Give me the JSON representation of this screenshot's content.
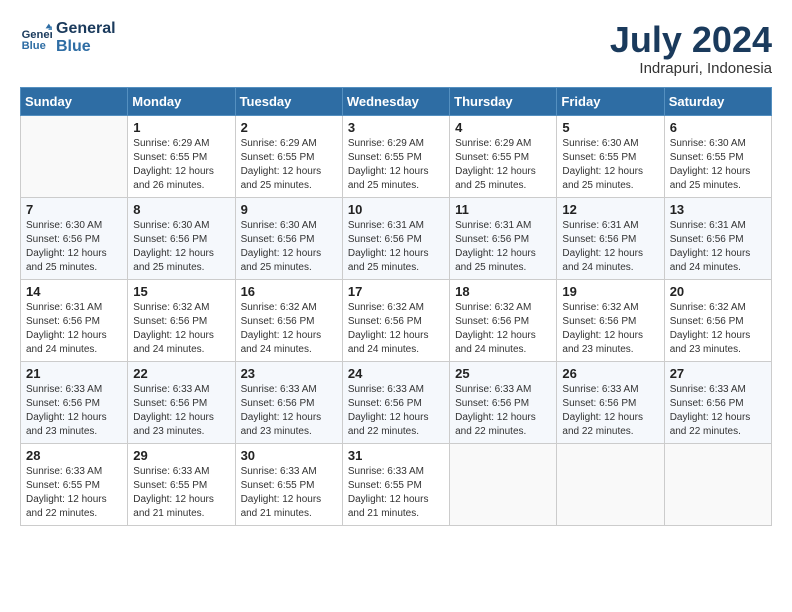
{
  "header": {
    "logo_line1": "General",
    "logo_line2": "Blue",
    "month": "July 2024",
    "location": "Indrapuri, Indonesia"
  },
  "weekdays": [
    "Sunday",
    "Monday",
    "Tuesday",
    "Wednesday",
    "Thursday",
    "Friday",
    "Saturday"
  ],
  "weeks": [
    [
      {
        "day": "",
        "info": ""
      },
      {
        "day": "1",
        "info": "Sunrise: 6:29 AM\nSunset: 6:55 PM\nDaylight: 12 hours\nand 26 minutes."
      },
      {
        "day": "2",
        "info": "Sunrise: 6:29 AM\nSunset: 6:55 PM\nDaylight: 12 hours\nand 25 minutes."
      },
      {
        "day": "3",
        "info": "Sunrise: 6:29 AM\nSunset: 6:55 PM\nDaylight: 12 hours\nand 25 minutes."
      },
      {
        "day": "4",
        "info": "Sunrise: 6:29 AM\nSunset: 6:55 PM\nDaylight: 12 hours\nand 25 minutes."
      },
      {
        "day": "5",
        "info": "Sunrise: 6:30 AM\nSunset: 6:55 PM\nDaylight: 12 hours\nand 25 minutes."
      },
      {
        "day": "6",
        "info": "Sunrise: 6:30 AM\nSunset: 6:55 PM\nDaylight: 12 hours\nand 25 minutes."
      }
    ],
    [
      {
        "day": "7",
        "info": "Sunrise: 6:30 AM\nSunset: 6:56 PM\nDaylight: 12 hours\nand 25 minutes."
      },
      {
        "day": "8",
        "info": "Sunrise: 6:30 AM\nSunset: 6:56 PM\nDaylight: 12 hours\nand 25 minutes."
      },
      {
        "day": "9",
        "info": "Sunrise: 6:30 AM\nSunset: 6:56 PM\nDaylight: 12 hours\nand 25 minutes."
      },
      {
        "day": "10",
        "info": "Sunrise: 6:31 AM\nSunset: 6:56 PM\nDaylight: 12 hours\nand 25 minutes."
      },
      {
        "day": "11",
        "info": "Sunrise: 6:31 AM\nSunset: 6:56 PM\nDaylight: 12 hours\nand 25 minutes."
      },
      {
        "day": "12",
        "info": "Sunrise: 6:31 AM\nSunset: 6:56 PM\nDaylight: 12 hours\nand 24 minutes."
      },
      {
        "day": "13",
        "info": "Sunrise: 6:31 AM\nSunset: 6:56 PM\nDaylight: 12 hours\nand 24 minutes."
      }
    ],
    [
      {
        "day": "14",
        "info": "Sunrise: 6:31 AM\nSunset: 6:56 PM\nDaylight: 12 hours\nand 24 minutes."
      },
      {
        "day": "15",
        "info": "Sunrise: 6:32 AM\nSunset: 6:56 PM\nDaylight: 12 hours\nand 24 minutes."
      },
      {
        "day": "16",
        "info": "Sunrise: 6:32 AM\nSunset: 6:56 PM\nDaylight: 12 hours\nand 24 minutes."
      },
      {
        "day": "17",
        "info": "Sunrise: 6:32 AM\nSunset: 6:56 PM\nDaylight: 12 hours\nand 24 minutes."
      },
      {
        "day": "18",
        "info": "Sunrise: 6:32 AM\nSunset: 6:56 PM\nDaylight: 12 hours\nand 24 minutes."
      },
      {
        "day": "19",
        "info": "Sunrise: 6:32 AM\nSunset: 6:56 PM\nDaylight: 12 hours\nand 23 minutes."
      },
      {
        "day": "20",
        "info": "Sunrise: 6:32 AM\nSunset: 6:56 PM\nDaylight: 12 hours\nand 23 minutes."
      }
    ],
    [
      {
        "day": "21",
        "info": "Sunrise: 6:33 AM\nSunset: 6:56 PM\nDaylight: 12 hours\nand 23 minutes."
      },
      {
        "day": "22",
        "info": "Sunrise: 6:33 AM\nSunset: 6:56 PM\nDaylight: 12 hours\nand 23 minutes."
      },
      {
        "day": "23",
        "info": "Sunrise: 6:33 AM\nSunset: 6:56 PM\nDaylight: 12 hours\nand 23 minutes."
      },
      {
        "day": "24",
        "info": "Sunrise: 6:33 AM\nSunset: 6:56 PM\nDaylight: 12 hours\nand 22 minutes."
      },
      {
        "day": "25",
        "info": "Sunrise: 6:33 AM\nSunset: 6:56 PM\nDaylight: 12 hours\nand 22 minutes."
      },
      {
        "day": "26",
        "info": "Sunrise: 6:33 AM\nSunset: 6:56 PM\nDaylight: 12 hours\nand 22 minutes."
      },
      {
        "day": "27",
        "info": "Sunrise: 6:33 AM\nSunset: 6:56 PM\nDaylight: 12 hours\nand 22 minutes."
      }
    ],
    [
      {
        "day": "28",
        "info": "Sunrise: 6:33 AM\nSunset: 6:55 PM\nDaylight: 12 hours\nand 22 minutes."
      },
      {
        "day": "29",
        "info": "Sunrise: 6:33 AM\nSunset: 6:55 PM\nDaylight: 12 hours\nand 21 minutes."
      },
      {
        "day": "30",
        "info": "Sunrise: 6:33 AM\nSunset: 6:55 PM\nDaylight: 12 hours\nand 21 minutes."
      },
      {
        "day": "31",
        "info": "Sunrise: 6:33 AM\nSunset: 6:55 PM\nDaylight: 12 hours\nand 21 minutes."
      },
      {
        "day": "",
        "info": ""
      },
      {
        "day": "",
        "info": ""
      },
      {
        "day": "",
        "info": ""
      }
    ]
  ]
}
